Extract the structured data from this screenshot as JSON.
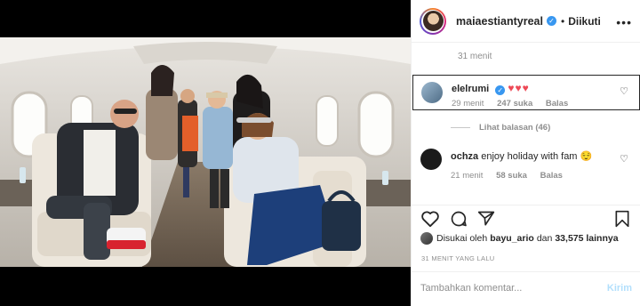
{
  "post_header": {
    "username": "maiaestiantyreal",
    "separator": "•",
    "follow_status": "Diikuti",
    "more_icon": "more-horizontal-icon"
  },
  "comments": {
    "top_time": "31 menit",
    "items": [
      {
        "username": "elelrumi",
        "text": "♥♥♥",
        "time": "29 menit",
        "likes": "247 suka",
        "reply": "Balas",
        "verified": true
      },
      {
        "username": "ochza",
        "text": "enjoy holiday with fam 😌",
        "time": "21 menit",
        "likes": "58 suka",
        "reply": "Balas",
        "verified": false
      }
    ],
    "view_replies": "Lihat balasan (46)"
  },
  "likes": {
    "prefix": "Disukai oleh",
    "user": "bayu_ario",
    "connector": "dan",
    "count": "33,575 lainnya"
  },
  "timestamp": "31 MENIT YANG LALU",
  "add_comment": {
    "placeholder": "Tambahkan komentar...",
    "post_label": "Kirim"
  },
  "colors": {
    "verified_blue": "#3897f0",
    "heart_red": "#ed4956",
    "post_disabled": "#b2dffc"
  }
}
